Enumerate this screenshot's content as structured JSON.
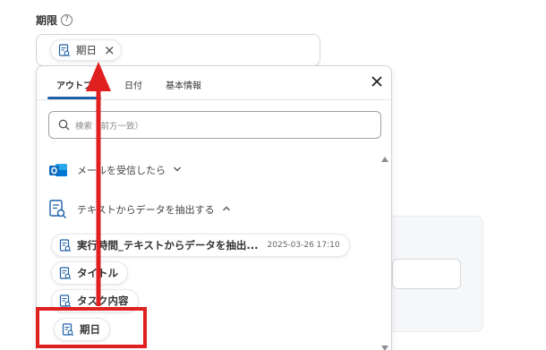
{
  "field": {
    "label": "期限",
    "help_icon": "?"
  },
  "selected_chip": {
    "label": "期日",
    "close_icon": "×"
  },
  "dropdown": {
    "tabs": [
      {
        "label": "アウトプット",
        "active": true
      },
      {
        "label": "日付",
        "active": false
      },
      {
        "label": "基本情報",
        "active": false
      }
    ],
    "search_placeholder": "検索（前方一致）",
    "sections": [
      {
        "label": "メールを受信したら",
        "chevron": "⌄",
        "icon": "outlook-icon"
      },
      {
        "label": "テキストからデータを抽出する",
        "chevron": "⌃",
        "icon": "document-search-icon"
      }
    ],
    "items": [
      {
        "label": "実行時間_テキストからデータを抽出...",
        "timestamp": "2025-03-26 17:10"
      },
      {
        "label": "タイトル"
      },
      {
        "label": "タスク内容"
      },
      {
        "label": "期日"
      }
    ]
  },
  "colors": {
    "accent": "#1e5fa8",
    "annotation_red": "#e01f1f",
    "outlook_blue": "#0f6cbd"
  }
}
